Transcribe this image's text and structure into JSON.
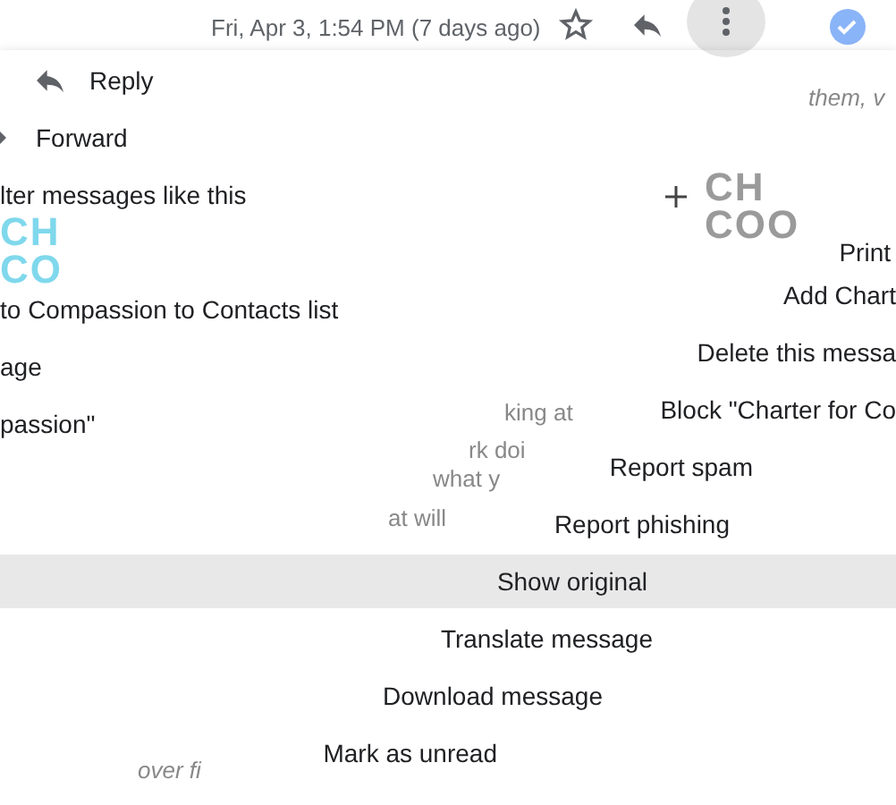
{
  "header": {
    "date": "Fri, Apr 3, 1:54 PM (7 days ago)"
  },
  "email_fragments": [
    {
      "text": "them, v",
      "italic": true
    },
    {
      "text": "king at",
      "italic": false
    },
    {
      "text": "rk doi",
      "italic": false
    },
    {
      "text": "what y",
      "italic": false
    },
    {
      "text": "at will",
      "italic": false
    },
    {
      "text": "over fi",
      "italic": true
    }
  ],
  "logos": [
    {
      "lines": [
        "CH",
        "CO"
      ],
      "color": "#7fd8ec"
    },
    {
      "lines": [
        "CH",
        "COO"
      ],
      "color": "#9a9a9a"
    }
  ],
  "menu_left": [
    {
      "label": "Reply"
    },
    {
      "label": "Forward"
    },
    {
      "label": "lter messages like this"
    },
    {
      "label": "to Compassion to Contacts list"
    },
    {
      "label": "age"
    },
    {
      "label": "passion\""
    }
  ],
  "menu_right": [
    {
      "label": "Print",
      "selected": false
    },
    {
      "label": "Add Chart",
      "selected": false
    },
    {
      "label": "Delete this messa",
      "selected": false
    },
    {
      "label": "Block \"Charter for Co",
      "selected": false
    },
    {
      "label": "Report spam",
      "selected": false
    },
    {
      "label": "Report phishing",
      "selected": false
    },
    {
      "label": "Show original",
      "selected": true
    },
    {
      "label": "Translate message",
      "selected": false
    },
    {
      "label": "Download message",
      "selected": false
    },
    {
      "label": "Mark as unread",
      "selected": false
    }
  ]
}
